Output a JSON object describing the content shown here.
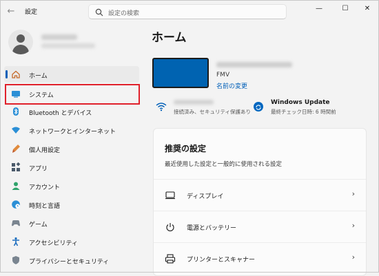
{
  "titlebar": {
    "app_title": "設定",
    "back_glyph": "←",
    "search_placeholder": "設定の検索",
    "minimize_glyph": "—",
    "maximize_glyph": "☐",
    "close_glyph": "✕"
  },
  "sidebar": {
    "items": [
      {
        "label": "ホーム",
        "icon": "home-icon"
      },
      {
        "label": "システム",
        "icon": "monitor-icon"
      },
      {
        "label": "Bluetooth とデバイス",
        "icon": "bluetooth-icon"
      },
      {
        "label": "ネットワークとインターネット",
        "icon": "wifi-icon"
      },
      {
        "label": "個人用設定",
        "icon": "brush-icon"
      },
      {
        "label": "アプリ",
        "icon": "apps-icon"
      },
      {
        "label": "アカウント",
        "icon": "person-icon"
      },
      {
        "label": "時刻と言語",
        "icon": "globe-clock-icon"
      },
      {
        "label": "ゲーム",
        "icon": "gamepad-icon"
      },
      {
        "label": "アクセシビリティ",
        "icon": "accessibility-icon"
      },
      {
        "label": "プライバシーとセキュリティ",
        "icon": "shield-icon"
      }
    ],
    "active_index": 0
  },
  "main": {
    "title": "ホーム",
    "device": {
      "model": "FMV",
      "rename_link": "名前の変更"
    },
    "network": {
      "status": "接続済み、セキュリティ保護あり"
    },
    "windows_update": {
      "title": "Windows Update",
      "status": "最終チェック日時: 6 時間前"
    },
    "recommended": {
      "title": "推奨の設定",
      "subtitle": "最近使用した設定と一般的に使用される設定",
      "rows": [
        {
          "label": "ディスプレイ",
          "icon": "display-icon"
        },
        {
          "label": "電源とバッテリー",
          "icon": "power-icon"
        },
        {
          "label": "プリンターとスキャナー",
          "icon": "printer-icon"
        }
      ],
      "chevron": "›"
    }
  },
  "colors": {
    "accent": "#005fb8",
    "highlight_box": "#e0202a",
    "device_screen": "#0063b1"
  }
}
